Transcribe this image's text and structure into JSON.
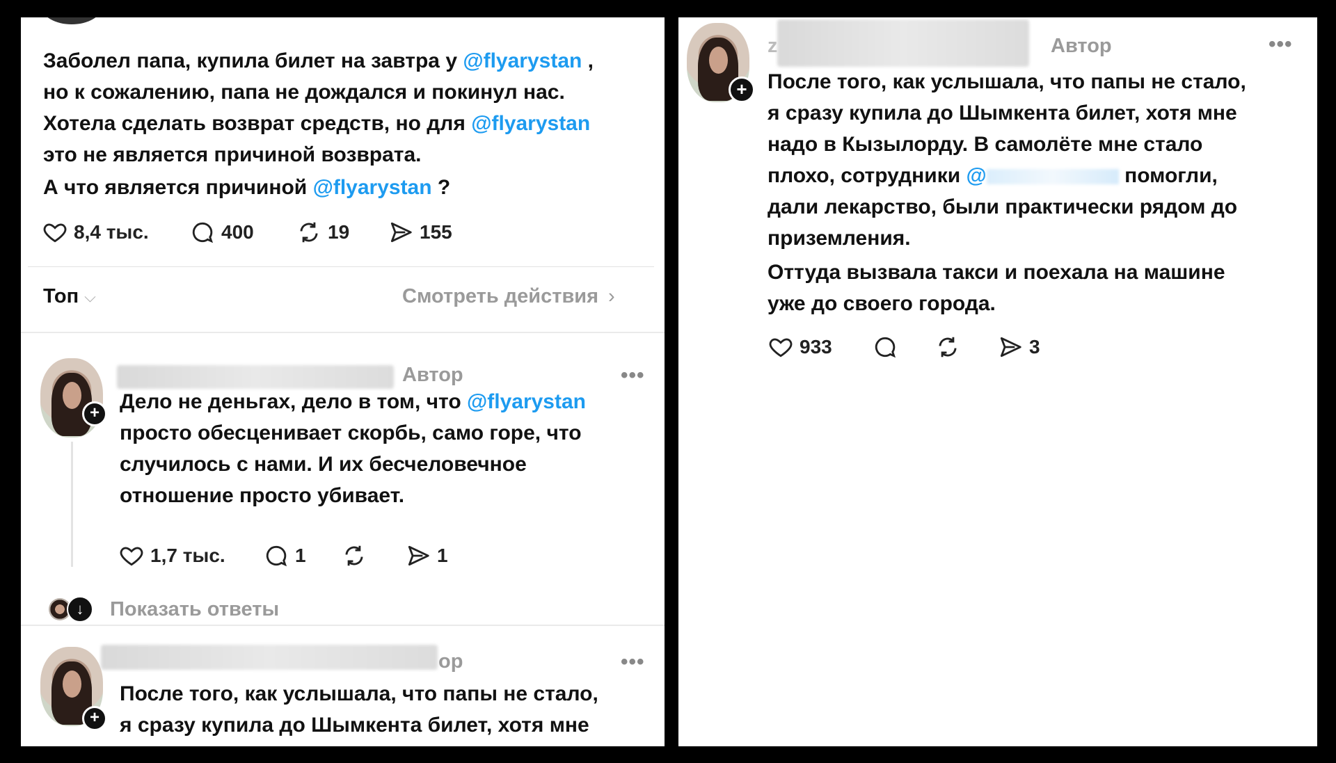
{
  "left": {
    "post": {
      "lines": [
        {
          "before": "Заболел папа, купила билет на завтра у ",
          "link": "@flyarystan",
          "after": " ,"
        },
        {
          "before": "но к сожалению, папа не дождался и покинул нас.",
          "link": "",
          "after": ""
        },
        {
          "before": "Хотела сделать возврат средств, но для ",
          "link": "@flyarystan",
          "after": ""
        },
        {
          "before": "это не является причиной возврата.",
          "link": "",
          "after": ""
        },
        {
          "before": "А что является причиной ",
          "link": "@flyarystan",
          "after": " ?"
        }
      ],
      "stats": {
        "likes": "8,4 тыс.",
        "replies": "400",
        "reposts": "19",
        "shares": "155"
      }
    },
    "sort": {
      "label": "Топ",
      "activity_link": "Смотреть действия"
    },
    "reply1": {
      "author_badge": "Автор",
      "lines": [
        {
          "before": "Дело не деньгах, дело в том, что ",
          "link": "@flyarystan",
          "after": ""
        },
        {
          "before": "просто обесценивает скорбь, само горе, что",
          "link": "",
          "after": ""
        },
        {
          "before": "случилось с нами. И их бесчеловечное",
          "link": "",
          "after": ""
        },
        {
          "before": "отношение просто убивает.",
          "link": "",
          "after": ""
        }
      ],
      "stats": {
        "likes": "1,7 тыс.",
        "replies": "1",
        "reposts": "",
        "shares": "1"
      }
    },
    "show_replies": "Показать ответы",
    "reply2": {
      "author_badge_partial": "ор",
      "lines": [
        "После того, как услышала, что папы не стало,",
        "я сразу купила до Шымкента билет, хотя мне"
      ]
    }
  },
  "right": {
    "reply": {
      "username_initial": "z",
      "author_badge": "Автор",
      "lines": [
        {
          "before": "После того, как услышала, что папы не стало,",
          "link": "",
          "after": ""
        },
        {
          "before": "я сразу купила до Шымкента билет, хотя мне",
          "link": "",
          "after": ""
        },
        {
          "before": "надо в Кызылорду. В самолёте мне стало",
          "link": "",
          "after": ""
        },
        {
          "before": "плохо, сотрудники ",
          "link": "@",
          "after": "   помогли,"
        },
        {
          "before": "дали лекарство, были практически рядом до",
          "link": "",
          "after": ""
        },
        {
          "before": "приземления.",
          "link": "",
          "after": ""
        },
        {
          "before": "Оттуда вызвала такси и поехала на машине",
          "link": "",
          "after": ""
        },
        {
          "before": "уже до своего города.",
          "link": "",
          "after": ""
        }
      ],
      "stats": {
        "likes": "933",
        "replies": "",
        "reposts": "",
        "shares": "3"
      }
    }
  },
  "more_glyph": "•••",
  "colors": {
    "link": "#1d9bf0",
    "muted": "#9a9a9a"
  }
}
